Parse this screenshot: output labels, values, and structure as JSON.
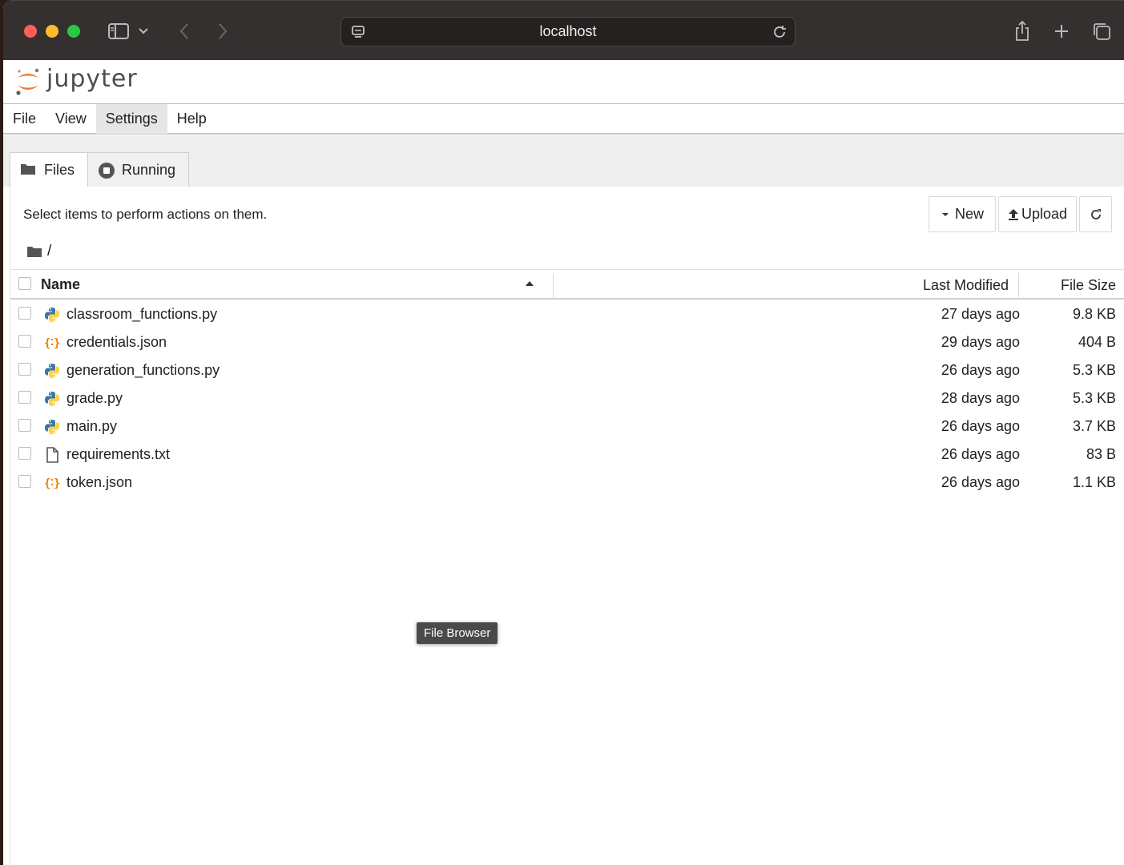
{
  "browser": {
    "url": "localhost"
  },
  "jupyter": {
    "logo_text": "jupyter"
  },
  "menu": {
    "items": [
      {
        "label": "File"
      },
      {
        "label": "View"
      },
      {
        "label": "Settings"
      },
      {
        "label": "Help"
      }
    ]
  },
  "tabs": {
    "files": "Files",
    "running": "Running"
  },
  "toolbar": {
    "select_text": "Select items to perform actions on them.",
    "new_label": "New",
    "upload_label": "Upload"
  },
  "breadcrumb": {
    "path": "/"
  },
  "list": {
    "headers": {
      "name": "Name",
      "last_modified": "Last Modified",
      "file_size": "File Size"
    },
    "files": [
      {
        "name": "classroom_functions.py",
        "type": "python",
        "modified": "27 days ago",
        "size": "9.8 KB"
      },
      {
        "name": "credentials.json",
        "type": "json",
        "modified": "29 days ago",
        "size": "404 B"
      },
      {
        "name": "generation_functions.py",
        "type": "python",
        "modified": "26 days ago",
        "size": "5.3 KB"
      },
      {
        "name": "grade.py",
        "type": "python",
        "modified": "28 days ago",
        "size": "5.3 KB"
      },
      {
        "name": "main.py",
        "type": "python",
        "modified": "26 days ago",
        "size": "3.7 KB"
      },
      {
        "name": "requirements.txt",
        "type": "text",
        "modified": "26 days ago",
        "size": "83 B"
      },
      {
        "name": "token.json",
        "type": "json",
        "modified": "26 days ago",
        "size": "1.1 KB"
      }
    ]
  },
  "tooltip": {
    "text": "File Browser"
  },
  "colors": {
    "jupyter_orange": "#f37726",
    "python_blue": "#3b77a8",
    "python_yellow": "#ffd343",
    "json_orange": "#f57c00"
  }
}
